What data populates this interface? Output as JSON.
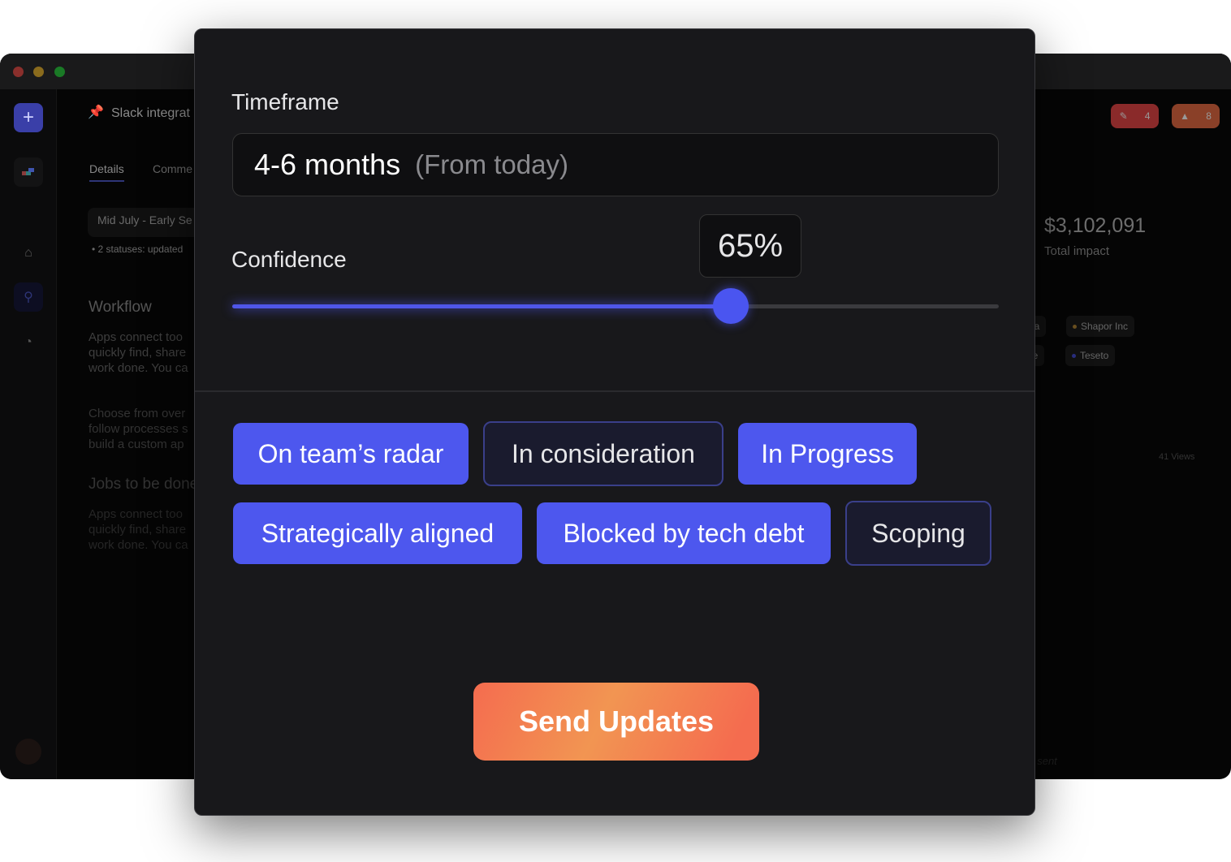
{
  "background_app": {
    "window_controls": {
      "close": "#e0443e",
      "minimize": "#dea123",
      "maximize": "#1aab29"
    },
    "sidebar": {
      "icons": [
        "plus-icon",
        "app-logo-icon",
        "home-icon",
        "search-icon",
        "pie-chart-icon"
      ]
    },
    "header": {
      "title": "Slack integrat",
      "pin_badge": "4",
      "alert_count": "4",
      "upvote_count": "8"
    },
    "tabs": [
      "Details",
      "Comme"
    ],
    "date_range": "Mid July - Early Se",
    "status_note": "• 2 statuses: updated",
    "sections": [
      {
        "heading": "Workflow",
        "lines": [
          "Apps connect too",
          "quickly find, share",
          "work done. You ca"
        ]
      },
      {
        "heading": "",
        "lines": [
          "Choose from over",
          "follow processes s",
          "build a custom ap"
        ]
      },
      {
        "heading": "Jobs to be done",
        "lines": [
          "Apps connect too",
          "quickly find, share",
          "work done. You ca"
        ]
      }
    ],
    "impact": {
      "value": "$3,102,091",
      "label": "Total impact"
    },
    "companies": [
      {
        "name": "ura",
        "color": ""
      },
      {
        "name": "Shapor Inc",
        "color": "#b8862e"
      },
      {
        "name": "ike",
        "color": ""
      },
      {
        "name": "Teseto",
        "color": "#3b46c8"
      }
    ],
    "views": "41 Views",
    "footer_note": "t sent"
  },
  "modal": {
    "timeframe": {
      "label": "Timeframe",
      "value": "4-6 months",
      "hint": "(From today)"
    },
    "confidence": {
      "label": "Confidence",
      "value_text": "65%",
      "value": 0.65
    },
    "tags": [
      {
        "label": "On team’s radar",
        "selected": true
      },
      {
        "label": "In consideration",
        "selected": false
      },
      {
        "label": "In Progress",
        "selected": true
      },
      {
        "label": "Strategically aligned",
        "selected": true
      },
      {
        "label": "Blocked by tech debt",
        "selected": true
      },
      {
        "label": "Scoping",
        "selected": false
      }
    ],
    "send_button": "Send Updates",
    "colors": {
      "accent": "#4d57ee",
      "send_gradient": [
        "#f46c4f",
        "#f29552"
      ]
    }
  }
}
